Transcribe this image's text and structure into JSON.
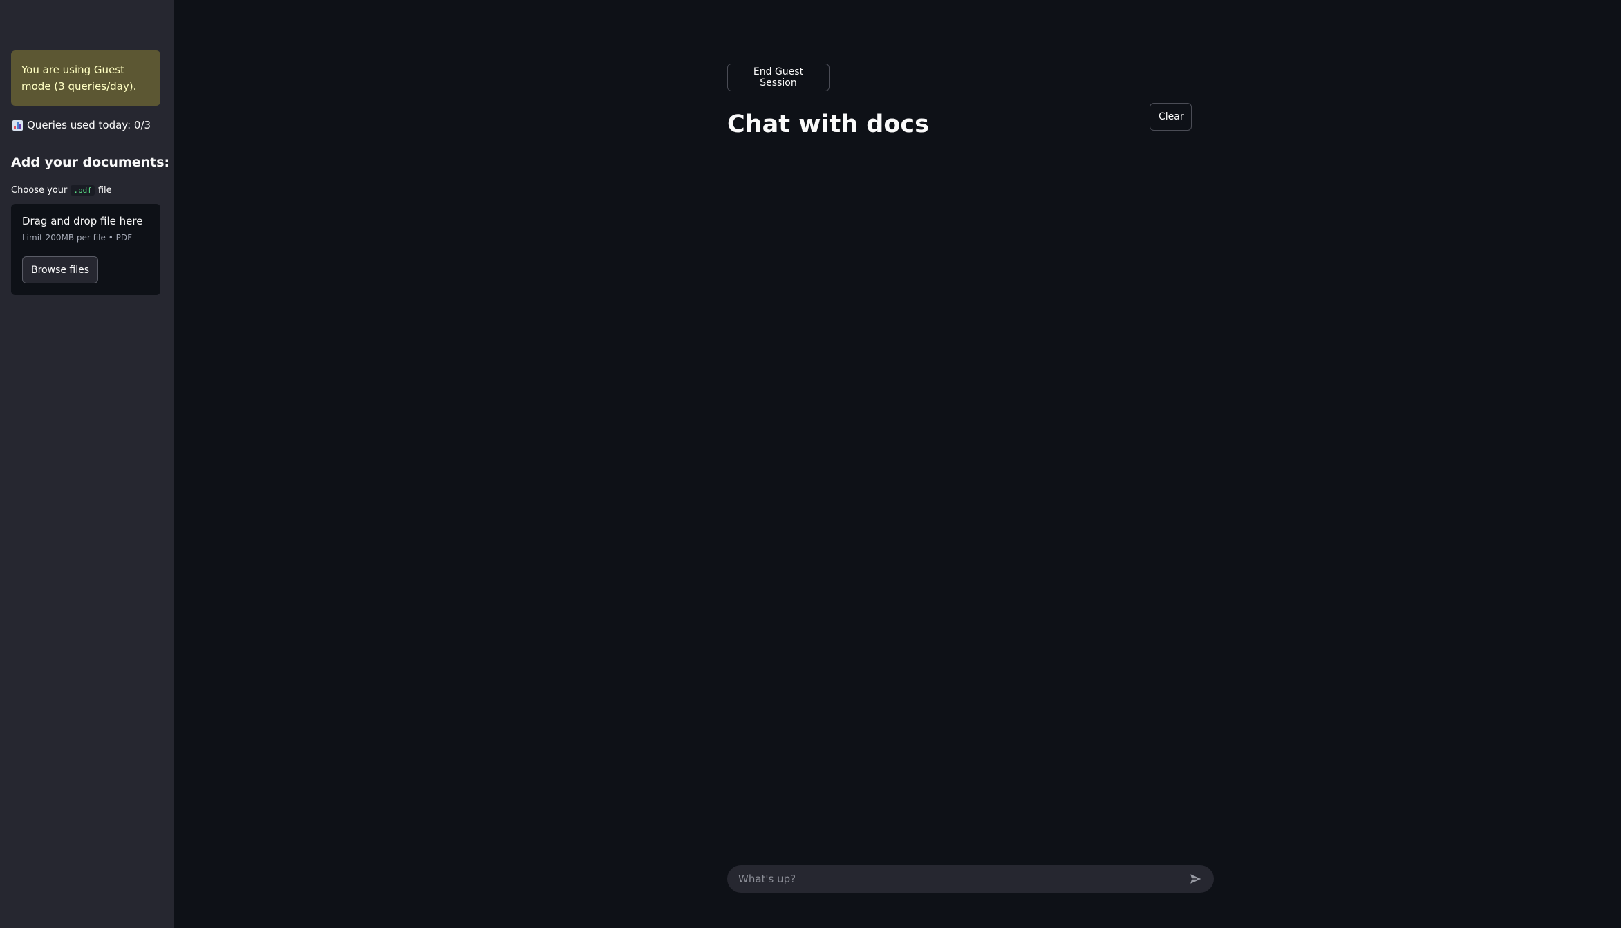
{
  "sidebar": {
    "guest_notice": "You are using Guest mode (3 queries/day).",
    "queries_used": "Queries used today: 0/3",
    "queries_icon": "bar-chart-icon",
    "add_docs_heading": "Add your documents:",
    "choose_prefix": "Choose your",
    "choose_code": ".pdf",
    "choose_suffix": "file",
    "dropzone": {
      "title": "Drag and drop file here",
      "limit": "Limit 200MB per file • PDF",
      "browse_label": "Browse files"
    }
  },
  "main": {
    "end_session_label": "End Guest Session",
    "title": "Chat with docs",
    "clear_label": "Clear",
    "chat_input": {
      "placeholder": "What's up?",
      "value": "",
      "send_icon": "send-icon"
    }
  },
  "colors": {
    "background": "#0e1117",
    "sidebar": "#262730",
    "warning_bg": "#5c5733",
    "warning_text": "#ffffc2",
    "code_text": "#5ce488"
  }
}
